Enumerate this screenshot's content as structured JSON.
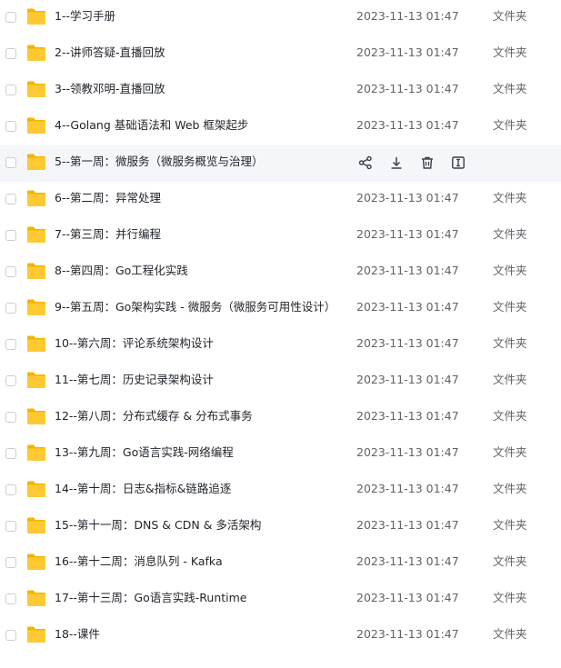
{
  "files": [
    {
      "name": "1--学习手册",
      "date": "2023-11-13 01:47",
      "type": "文件夹"
    },
    {
      "name": "2--讲师答疑-直播回放",
      "date": "2023-11-13 01:47",
      "type": "文件夹"
    },
    {
      "name": "3--领教邓明-直播回放",
      "date": "2023-11-13 01:47",
      "type": "文件夹"
    },
    {
      "name": "4--Golang 基础语法和 Web 框架起步",
      "date": "2023-11-13 01:47",
      "type": "文件夹"
    },
    {
      "name": "5--第一周：微服务（微服务概览与治理）",
      "date": "",
      "type": "",
      "hovered": true
    },
    {
      "name": "6--第二周：异常处理",
      "date": "2023-11-13 01:47",
      "type": "文件夹"
    },
    {
      "name": "7--第三周：并行编程",
      "date": "2023-11-13 01:47",
      "type": "文件夹"
    },
    {
      "name": "8--第四周：Go工程化实践",
      "date": "2023-11-13 01:47",
      "type": "文件夹"
    },
    {
      "name": "9--第五周：Go架构实践 - 微服务（微服务可用性设计）",
      "date": "2023-11-13 01:47",
      "type": "文件夹"
    },
    {
      "name": "10--第六周：评论系统架构设计",
      "date": "2023-11-13 01:47",
      "type": "文件夹"
    },
    {
      "name": "11--第七周：历史记录架构设计",
      "date": "2023-11-13 01:47",
      "type": "文件夹"
    },
    {
      "name": "12--第八周：分布式缓存 & 分布式事务",
      "date": "2023-11-13 01:47",
      "type": "文件夹"
    },
    {
      "name": "13--第九周：Go语言实践-网络编程",
      "date": "2023-11-13 01:47",
      "type": "文件夹"
    },
    {
      "name": "14--第十周：日志&指标&链路追逐",
      "date": "2023-11-13 01:47",
      "type": "文件夹"
    },
    {
      "name": "15--第十一周：DNS & CDN & 多活架构",
      "date": "2023-11-13 01:47",
      "type": "文件夹"
    },
    {
      "name": "16--第十二周：消息队列 - Kafka",
      "date": "2023-11-13 01:47",
      "type": "文件夹"
    },
    {
      "name": "17--第十三周：Go语言实践-Runtime",
      "date": "2023-11-13 01:47",
      "type": "文件夹"
    },
    {
      "name": "18--课件",
      "date": "2023-11-13 01:47",
      "type": "文件夹"
    }
  ],
  "hover_actions": [
    {
      "name": "share-icon"
    },
    {
      "name": "download-icon"
    },
    {
      "name": "delete-icon"
    },
    {
      "name": "rename-icon"
    }
  ],
  "colors": {
    "folder": "#ffc933",
    "folder_tab": "#f5b400",
    "hover_row": "#f5f6fa",
    "icon": "#3b3f45"
  }
}
